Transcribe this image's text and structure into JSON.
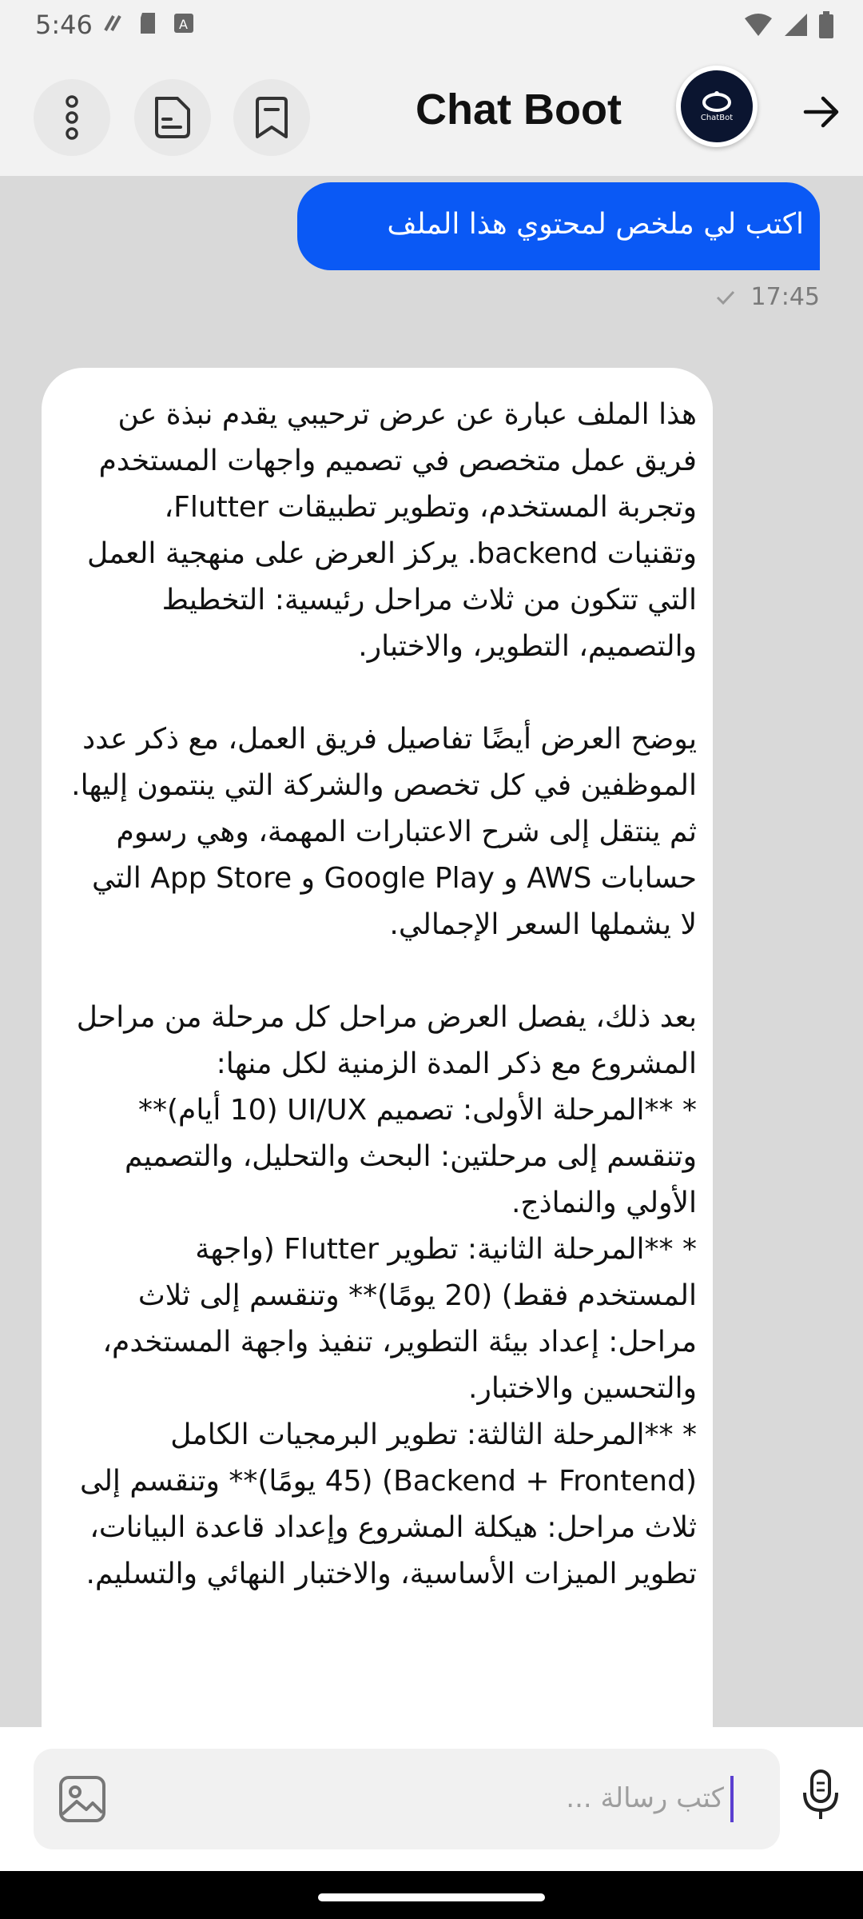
{
  "status_bar": {
    "time": "5:46"
  },
  "header": {
    "title": "Chat Boot",
    "avatar_label": "ChatBot",
    "icons": [
      "more-vert-icon",
      "document-icon",
      "bookmark-icon",
      "arrow-right-icon"
    ]
  },
  "messages": {
    "user": {
      "text": "اكتب لي ملخص لمحتوي هذا الملف",
      "time": "17:45"
    },
    "bot": {
      "text": "هذا الملف عبارة عن عرض ترحيبي يقدم نبذة عن فريق عمل متخصص في تصميم واجهات المستخدم وتجربة المستخدم، وتطوير تطبيقات Flutter، وتقنيات backend.  يركز العرض على منهجية العمل التي تتكون من ثلاث مراحل رئيسية: التخطيط والتصميم، التطوير، والاختبار.\n\nيوضح العرض أيضًا تفاصيل فريق العمل، مع ذكر عدد الموظفين في كل تخصص والشركة التي ينتمون إليها.  ثم ينتقل إلى شرح الاعتبارات المهمة، وهي رسوم حسابات AWS و Google Play و App Store التي لا يشملها السعر الإجمالي.\n\nبعد ذلك، يفصل العرض مراحل كل مرحلة من مراحل المشروع مع ذكر المدة الزمنية لكل منها:\n* **المرحلة الأولى: تصميم UI/UX (10 أيام)** وتنقسم إلى مرحلتين: البحث والتحليل، والتصميم الأولي والنماذج.\n* **المرحلة الثانية: تطوير Flutter (واجهة المستخدم فقط) (20 يومًا)** وتنقسم إلى ثلاث مراحل: إعداد بيئة التطوير، تنفيذ واجهة المستخدم، والتحسين والاختبار.\n* **المرحلة الثالثة: تطوير البرمجيات الكامل (Backend + Frontend) (45 يومًا)** وتنقسم إلى ثلاث مراحل: هيكلة المشروع وإعداد قاعدة البيانات، تطوير الميزات الأساسية، والاختبار النهائي والتسليم."
    }
  },
  "composer": {
    "placeholder": "كتب رسالة ..."
  },
  "colors": {
    "accent": "#0a59f5",
    "background": "#d9d9d9",
    "header": "#f2f2f2"
  }
}
